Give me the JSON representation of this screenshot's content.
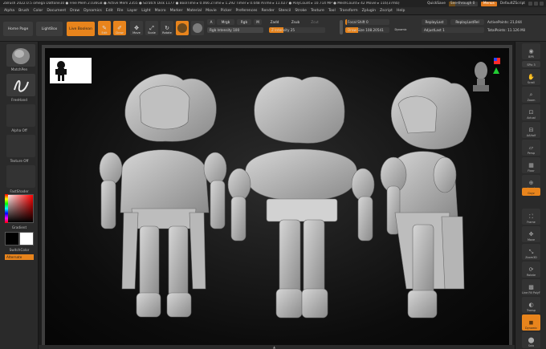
{
  "titlebar": {
    "text": "ZBrush 2022.0.5     omega Dattone10   ● Free Mem 2.036GB ● Active Mem 2355 ● Scratch Disk 1177 ● BoolTime ▸ 0.066 ZTime ▸ 1.292 Timer ▸ 0.048 ATime ▸ 11.027 ● PolyCount ▸ 10.714 MP ● MeshCount ▸ 42  Movie ▸ 116(37mb)",
    "quicksave": "QuickSave",
    "seethrough": "See-through  0",
    "menus": "Menus",
    "default_script": "DefaultZScript"
  },
  "menubar": [
    "Alpha",
    "Brush",
    "Color",
    "Document",
    "Draw",
    "Dynamics",
    "Edit",
    "File",
    "Layer",
    "Light",
    "Macro",
    "Marker",
    "Material",
    "Movie",
    "Picker",
    "Preferences",
    "Render",
    "Stencil",
    "Stroke",
    "Texture",
    "Tool",
    "Transform",
    "Zplugin",
    "Zscript",
    "Help"
  ],
  "toolbar": {
    "home_page": "Home Page",
    "lightbox": "LightBox",
    "live_boolean": "Live Boolean",
    "edit": "Edit",
    "draw": "Draw",
    "move": "Move",
    "scale": "Scale",
    "rotate": "Rotate",
    "a_label": "A",
    "mrgb": "Mrgb",
    "rgb": "Rgb",
    "m": "M",
    "zadd": "Zadd",
    "zsub": "Zsub",
    "zcut": "Zcut",
    "rgb_intensity": "Rgb Intensity 100",
    "z_intensity": "Z Intensity 25",
    "focal_shift": "Focal Shift 0",
    "draw_size": "Draw Size 108.20541",
    "dynamic": "Dynamic",
    "replay_last": "ReplayLast",
    "replay_last_rel": "ReplayLastRel",
    "adjust_last": "AdjustLast 1",
    "active_points": "ActivePoints: 21,044",
    "total_points": "TotalPoints: 11.126 Mil"
  },
  "left_shelf": {
    "brush_label": "MatchPen",
    "stroke_label": "FreeHand",
    "alpha_label": "Alpha Off",
    "texture_label": "Texture Off",
    "material_label": "FastShader",
    "gradient_label": "Gradient",
    "switch_color_label": "SwitchColor",
    "alternate_label": "Alternate"
  },
  "right_shelf": [
    {
      "name": "bpr",
      "label": "BPR"
    },
    {
      "name": "spix",
      "label": "SPix 3"
    },
    {
      "name": "scroll",
      "label": "Scroll"
    },
    {
      "name": "zoom",
      "label": "Zoom"
    },
    {
      "name": "actual",
      "label": "Actual"
    },
    {
      "name": "aahalf",
      "label": "AAHalf"
    },
    {
      "name": "persp",
      "label": "Persp"
    },
    {
      "name": "floor",
      "label": "Floor"
    },
    {
      "name": "local",
      "label": "Local"
    },
    {
      "name": "gxyz",
      "label": "Gxyz"
    },
    {
      "name": "frame",
      "label": "Frame"
    },
    {
      "name": "move",
      "label": "Move"
    },
    {
      "name": "zoom3d",
      "label": "Zoom3D"
    },
    {
      "name": "rotate",
      "label": "Rotate"
    },
    {
      "name": "line_fill",
      "label": "Line Fill PolyF"
    },
    {
      "name": "transp",
      "label": "Transp"
    },
    {
      "name": "dynamic",
      "label": "Dynamic"
    },
    {
      "name": "solo",
      "label": "Solo"
    }
  ],
  "colors": {
    "accent": "#e8841c",
    "panel": "#2a2a2a",
    "viewport": "#0c0c0c",
    "model": "#b5b5b5"
  }
}
